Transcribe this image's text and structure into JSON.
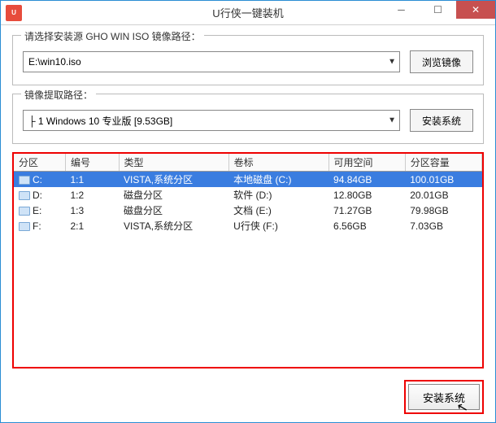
{
  "title": "U行侠一键装机",
  "app_icon_text": "U",
  "group_iso": {
    "label": "请选择安装源 GHO WIN ISO 镜像路径：",
    "value": "E:\\win10.iso",
    "browse_label": "浏览镜像"
  },
  "group_extract": {
    "label": "镜像提取路径：",
    "value": "├ 1 Windows 10 专业版 [9.53GB]",
    "install_label": "安装系统"
  },
  "table": {
    "headers": {
      "partition": "分区",
      "number": "编号",
      "type": "类型",
      "volume": "卷标",
      "free": "可用空间",
      "capacity": "分区容量"
    },
    "rows": [
      {
        "partition": "C:",
        "number": "1:1",
        "type": "VISTA,系统分区",
        "volume": "本地磁盘 (C:)",
        "free": "94.84GB",
        "capacity": "100.01GB",
        "selected": true
      },
      {
        "partition": "D:",
        "number": "1:2",
        "type": "磁盘分区",
        "volume": "软件 (D:)",
        "free": "12.80GB",
        "capacity": "20.01GB",
        "selected": false
      },
      {
        "partition": "E:",
        "number": "1:3",
        "type": "磁盘分区",
        "volume": "文档 (E:)",
        "free": "71.27GB",
        "capacity": "79.98GB",
        "selected": false
      },
      {
        "partition": "F:",
        "number": "2:1",
        "type": "VISTA,系统分区",
        "volume": "U行侠 (F:)",
        "free": "6.56GB",
        "capacity": "7.03GB",
        "selected": false
      }
    ]
  },
  "footer": {
    "install_label": "安装系统"
  }
}
